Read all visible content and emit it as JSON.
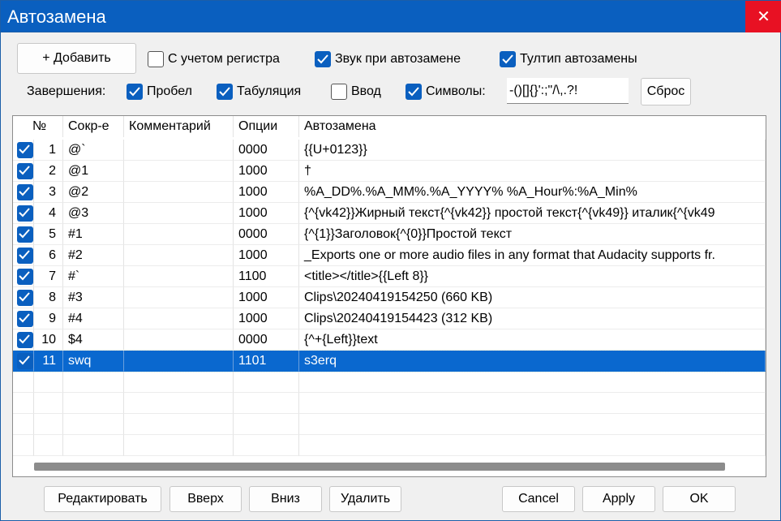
{
  "window": {
    "title": "Автозамена",
    "close_glyph": "✕"
  },
  "toolbar": {
    "add_label": "+ Добавить",
    "case_label": "С учетом регистра",
    "case_checked": false,
    "sound_label": "Звук при автозамене",
    "sound_checked": true,
    "tooltip_label": "Тултип автозамены",
    "tooltip_checked": true
  },
  "endings": {
    "label": "Завершения:",
    "space_label": "Пробел",
    "space_checked": true,
    "tab_label": "Табуляция",
    "tab_checked": true,
    "enter_label": "Ввод",
    "enter_checked": false,
    "symbols_label": "Символы:",
    "symbols_checked": true,
    "symbols_value": "-()[]{}':;\"/\\,.?!",
    "reset_label": "Сброс"
  },
  "table": {
    "columns": [
      "№",
      "Сокр-е",
      "Комментарий",
      "Опции",
      "Автозамена"
    ],
    "rows": [
      {
        "checked": true,
        "num": "1",
        "abbr": "@`",
        "comment": "",
        "options": "0000",
        "replace": "{{U+0123}}"
      },
      {
        "checked": true,
        "num": "2",
        "abbr": "@1",
        "comment": "",
        "options": "1000",
        "replace": "†"
      },
      {
        "checked": true,
        "num": "3",
        "abbr": "@2",
        "comment": "",
        "options": "1000",
        "replace": "%A_DD%.%A_MM%.%A_YYYY%  %A_Hour%:%A_Min%"
      },
      {
        "checked": true,
        "num": "4",
        "abbr": "@3",
        "comment": "",
        "options": "1000",
        "replace": "{^{vk42}}Жирный текст{^{vk42}} простой текст{^{vk49}} италик{^{vk49"
      },
      {
        "checked": true,
        "num": "5",
        "abbr": "#1",
        "comment": "",
        "options": "0000",
        "replace": "{^{1}}Заголовок{^{0}}Простой текст"
      },
      {
        "checked": true,
        "num": "6",
        "abbr": "#2",
        "comment": "",
        "options": "1000",
        "replace": "_Exports one or more audio files in any format that Audacity supports fr."
      },
      {
        "checked": true,
        "num": "7",
        "abbr": "#`",
        "comment": "",
        "options": "1100",
        "replace": "<title></title>{{Left 8}}"
      },
      {
        "checked": true,
        "num": "8",
        "abbr": "#3",
        "comment": "",
        "options": "1000",
        "replace": "Clips\\20240419154250  (660 KB)"
      },
      {
        "checked": true,
        "num": "9",
        "abbr": "#4",
        "comment": "",
        "options": "1000",
        "replace": "Clips\\20240419154423  (312 KB)"
      },
      {
        "checked": true,
        "num": "10",
        "abbr": "$4",
        "comment": "",
        "options": "0000",
        "replace": "{^+{Left}}text"
      },
      {
        "checked": true,
        "num": "11",
        "abbr": "swq",
        "comment": "",
        "options": "1101",
        "replace": "s3erq",
        "selected": true
      }
    ]
  },
  "footer": {
    "edit_label": "Редактировать",
    "up_label": "Вверх",
    "down_label": "Вниз",
    "delete_label": "Удалить",
    "cancel_label": "Cancel",
    "apply_label": "Apply",
    "ok_label": "OK"
  },
  "colors": {
    "accent": "#0a5fbf",
    "selection": "#0a68cf",
    "close": "#e81123"
  }
}
